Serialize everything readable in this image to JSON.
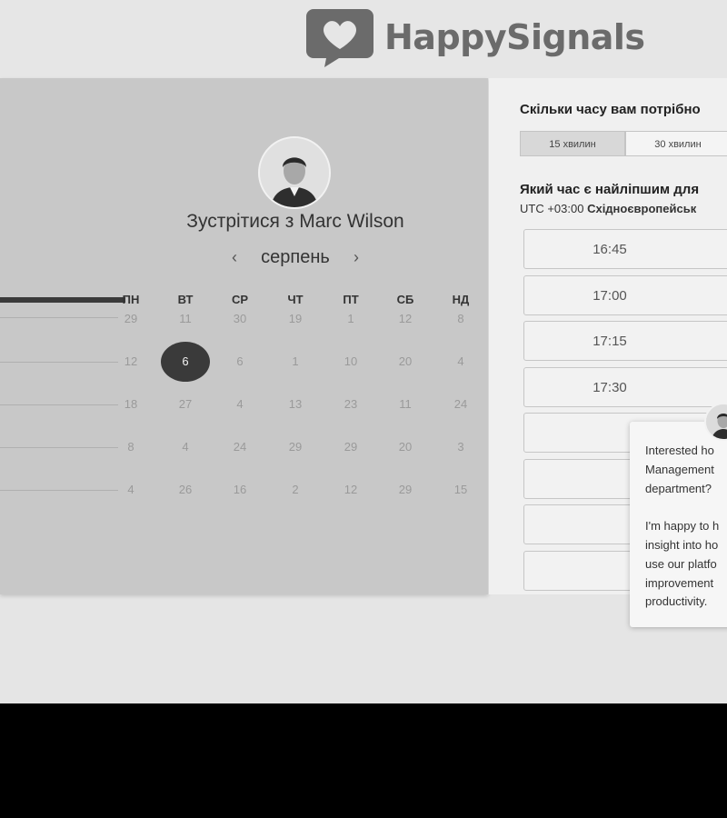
{
  "header": {
    "logo_text": "HappySignals"
  },
  "calendar": {
    "title": "Зустрітися з Marc Wilson",
    "month": "серпень",
    "prev": "‹",
    "next": "›",
    "weekdays": [
      "ПН",
      "ВТ",
      "СР",
      "ЧТ",
      "ПТ",
      "СБ",
      "НД"
    ],
    "weeks": [
      [
        "29",
        "11",
        "30",
        "19",
        "1",
        "12",
        "8"
      ],
      [
        "12",
        "6",
        "6",
        "1",
        "10",
        "20",
        "4"
      ],
      [
        "18",
        "27",
        "4",
        "13",
        "23",
        "11",
        "24"
      ],
      [
        "8",
        "4",
        "24",
        "29",
        "29",
        "20",
        "3"
      ],
      [
        "4",
        "26",
        "16",
        "2",
        "12",
        "29",
        "15"
      ]
    ],
    "selected_day": "6"
  },
  "booking": {
    "duration_question": "Скільки часу вам потрібно",
    "durations": [
      "15 хвилин",
      "30 хвилин"
    ],
    "active_duration": "15 хвилин",
    "time_question": "Який час є найліпшим для",
    "timezone_offset": "UTC +03:00",
    "timezone_name": "Східноєвропейськ",
    "slots": [
      "16:45",
      "17:00",
      "17:15",
      "17:30",
      "",
      "",
      "",
      ""
    ]
  },
  "chat": {
    "message": "Interested ho\nManagement\ndepartment?\n\nI'm happy to h\ninsight into ho\nuse our platfo\nimprovement\nproductivity."
  }
}
